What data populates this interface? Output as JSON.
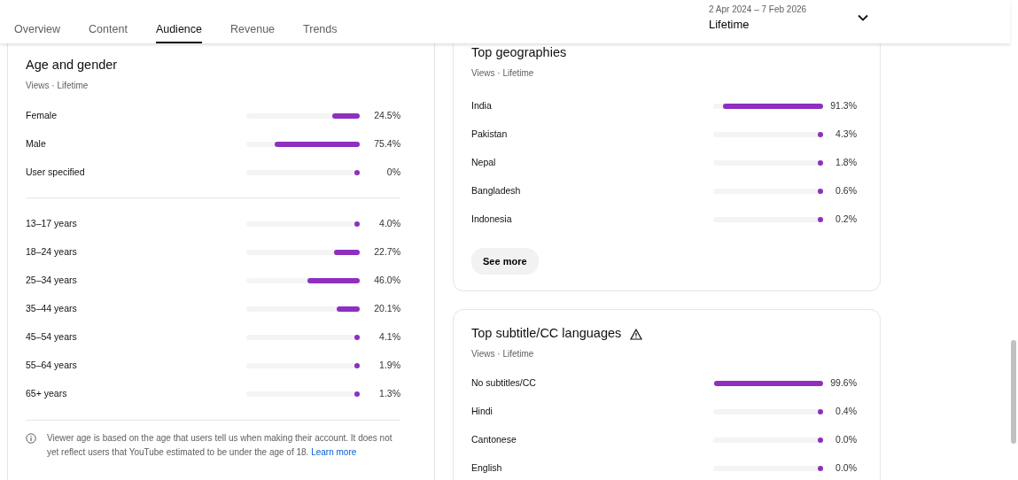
{
  "tabs": [
    {
      "label": "Overview",
      "selected": false
    },
    {
      "label": "Content",
      "selected": false
    },
    {
      "label": "Audience",
      "selected": true
    },
    {
      "label": "Revenue",
      "selected": false
    },
    {
      "label": "Trends",
      "selected": false
    }
  ],
  "date_range": {
    "range": "2 Apr 2024 – 7 Feb 2026",
    "period": "Lifetime"
  },
  "age_gender": {
    "title": "Age and gender",
    "subtitle": "Views · Lifetime",
    "gender": [
      {
        "label": "Female",
        "level": 0.245,
        "reading": "24.5%"
      },
      {
        "label": "Male",
        "level": 0.754,
        "reading": "75.4%"
      },
      {
        "label": "User specified",
        "level": 0,
        "reading": "0%"
      }
    ],
    "age": [
      {
        "label": "13–17 years",
        "level": 0.04,
        "reading": "4.0%"
      },
      {
        "label": "18–24 years",
        "level": 0.227,
        "reading": "22.7%"
      },
      {
        "label": "25–34 years",
        "level": 0.46,
        "reading": "46.0%"
      },
      {
        "label": "35–44 years",
        "level": 0.201,
        "reading": "20.1%"
      },
      {
        "label": "45–54 years",
        "level": 0.041,
        "reading": "4.1%"
      },
      {
        "label": "55–64 years",
        "level": 0.019,
        "reading": "1.9%"
      },
      {
        "label": "65+ years",
        "level": 0.013,
        "reading": "1.3%"
      }
    ],
    "note": "Viewer age is based on the age that users tell us when making their account. It does not yet reflect users that YouTube estimated to be under the age of 18.",
    "note_link": "Learn more"
  },
  "top_geographies": {
    "title": "Top geographies",
    "subtitle": "Views · Lifetime",
    "rows": [
      {
        "label": "India",
        "level": 0.913,
        "reading": "91.3%"
      },
      {
        "label": "Pakistan",
        "level": 0.043,
        "reading": "4.3%"
      },
      {
        "label": "Nepal",
        "level": 0.018,
        "reading": "1.8%"
      },
      {
        "label": "Bangladesh",
        "level": 0.006,
        "reading": "0.6%"
      },
      {
        "label": "Indonesia",
        "level": 0.002,
        "reading": "0.2%"
      }
    ],
    "button": "See more"
  },
  "top_subtitle_languages": {
    "title": "Top subtitle/CC languages",
    "subtitle": "Views · Lifetime",
    "warning": true,
    "rows": [
      {
        "label": "No subtitles/CC",
        "level": 0.996,
        "reading": "99.6%"
      },
      {
        "label": "Hindi",
        "level": 0.004,
        "reading": "0.4%"
      },
      {
        "label": "Cantonese",
        "level": 0,
        "reading": "0.0%"
      },
      {
        "label": "English",
        "level": 0,
        "reading": "0.0%"
      }
    ]
  }
}
